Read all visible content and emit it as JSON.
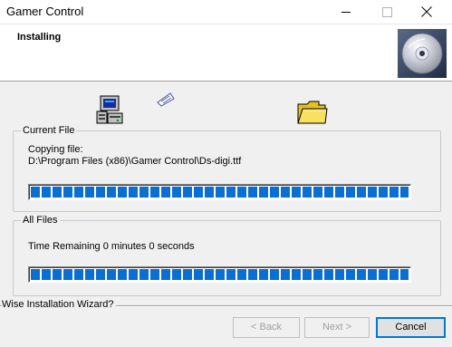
{
  "window": {
    "title": "Gamer Control"
  },
  "header": {
    "title": "Installing"
  },
  "current_file": {
    "legend": "Current File",
    "action_label": "Copying file:",
    "path": "D:\\Program Files (x86)\\Gamer Control\\Ds-digi.ttf",
    "progress": 1.0
  },
  "all_files": {
    "legend": "All Files",
    "time_remaining": "Time Remaining 0 minutes 0 seconds",
    "progress": 1.0
  },
  "footer": {
    "label": "Wise Installation Wizard?"
  },
  "buttons": {
    "back": "< Back",
    "next": "Next >",
    "cancel": "Cancel"
  },
  "colors": {
    "progress_blue": "#0b6fd2",
    "focus_border": "#0078d7"
  },
  "icons": {
    "computer": "computer-icon",
    "paper": "flying-paper-icon",
    "folder": "folder-icon",
    "disc": "cd-disc-icon"
  }
}
